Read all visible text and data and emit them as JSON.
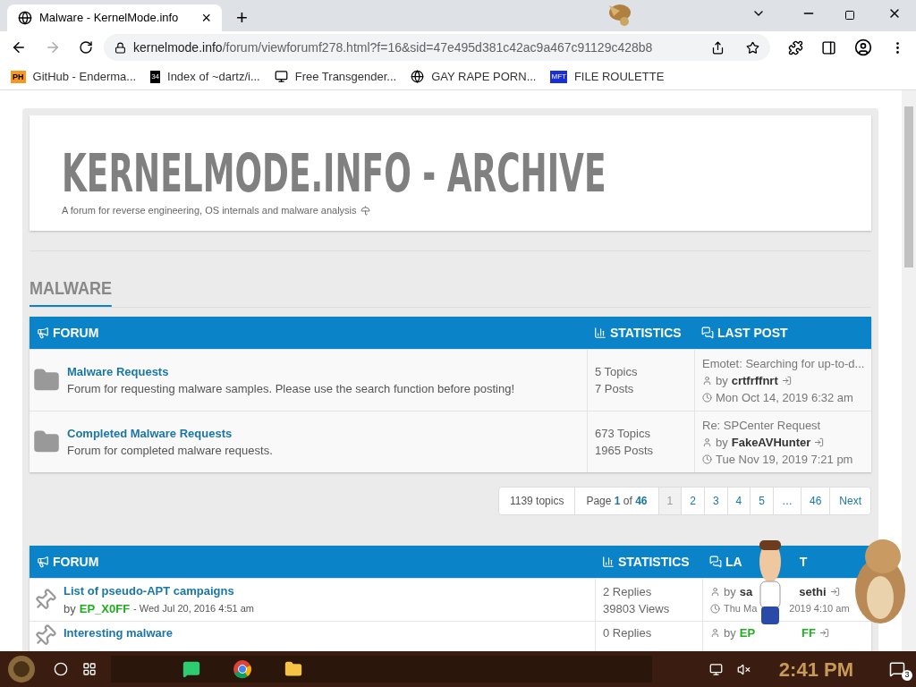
{
  "browser": {
    "tab": {
      "title": "Malware - KernelMode.info",
      "close": "×",
      "new_tab": "+"
    },
    "address": {
      "host": "kernelmode.info",
      "path": "/forum/viewforumf278.html?f=16&sid=47e495d381c42ac9a467c91129c428b8"
    },
    "bookmarks": [
      {
        "kind": "ph",
        "badge": "PH",
        "label": "GitHub - Enderma..."
      },
      {
        "kind": "grid",
        "badge": "34",
        "label": "Index of ~dartz/i..."
      },
      {
        "kind": "pc",
        "label": "Free Transgender..."
      },
      {
        "kind": "globe",
        "label": "GAY RAPE PORN..."
      },
      {
        "kind": "mft",
        "badge": "MFT",
        "label": "FILE ROULETTE"
      }
    ]
  },
  "site": {
    "title": "KERNELMODE.INFO - ARCHIVE",
    "subtitle": "A forum for reverse engineering, OS internals and malware analysis"
  },
  "section": {
    "title": "MALWARE"
  },
  "forums": {
    "columns": [
      "FORUM",
      "STATISTICS",
      "LAST POST"
    ],
    "rows": [
      {
        "title": "Malware Requests",
        "description": "Forum for requesting malware samples. Please use the search function before posting!",
        "topics": "5 Topics",
        "posts": "7 Posts",
        "last_title": "Emotet: Searching for up-to-d...",
        "by": "by",
        "author": "crtfrffnrt",
        "time": "Mon Oct 14, 2019 6:32 am"
      },
      {
        "title": "Completed Malware Requests",
        "description": "Forum for completed malware requests.",
        "topics": "673 Topics",
        "posts": "1965 Posts",
        "last_title": "Re: SPCenter Request",
        "by": "by",
        "author": "FakeAVHunter",
        "time": "Tue Nov 19, 2019 7:21 pm"
      }
    ]
  },
  "pagination": {
    "count": "1139 topics",
    "page_of": "Page **1** of **46**",
    "pages": [
      {
        "label": "1",
        "selected": true
      },
      {
        "label": "2",
        "selected": false
      },
      {
        "label": "3",
        "selected": false
      },
      {
        "label": "4",
        "selected": false
      },
      {
        "label": "5",
        "selected": false
      },
      {
        "label": "…",
        "selected": false
      },
      {
        "label": "46",
        "selected": false
      }
    ],
    "next": "Next"
  },
  "topics": {
    "columns": [
      "FORUM",
      "STATISTICS",
      "LA",
      "T"
    ],
    "rows": [
      {
        "title": "List of pseudo-APT campaigns",
        "by": "by",
        "author": "EP_X0FF",
        "date": "- Wed Jul 20, 2016 4:51 am",
        "replies": "2 Replies",
        "views": "39803 Views",
        "last_by": "by",
        "last_author_start": "sa",
        "last_author_end": "sethi",
        "last_time_start": "Thu Ma",
        "last_time_end": "2019 4:10 am"
      },
      {
        "title": "Interesting malware",
        "replies": "0 Replies",
        "last_by": "by",
        "last_author_start": "EP",
        "last_author_end": "FF"
      }
    ]
  },
  "taskbar": {
    "time": "2:41 PM",
    "notifications": "3"
  }
}
